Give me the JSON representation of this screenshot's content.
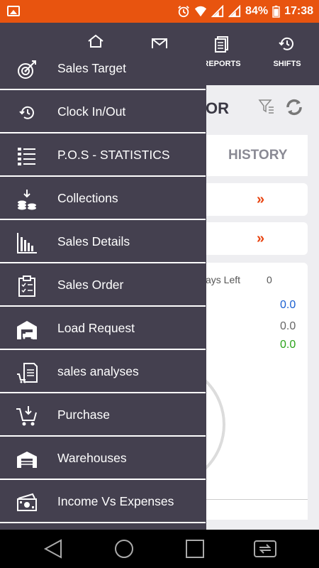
{
  "status_bar": {
    "battery_percent": "84%",
    "time": "17:38"
  },
  "background_app": {
    "tabs": [
      {
        "label": "",
        "icon": "home-icon"
      },
      {
        "label": "",
        "icon": "mail-icon"
      },
      {
        "label": "REPORTS",
        "icon": "reports-icon"
      },
      {
        "label": "SHIFTS",
        "icon": "history-icon"
      }
    ],
    "title_fragment": "OR",
    "history_label": "HISTORY",
    "arrow_glyph": "»",
    "days_left_label": "ays Left",
    "days_left_value": "0",
    "values": [
      {
        "text": "0.0",
        "color": "#1a5fd1"
      },
      {
        "text": "0.0",
        "color": "#666666"
      },
      {
        "text": "0.0",
        "color": "#2aa31a"
      }
    ]
  },
  "drawer": {
    "items": [
      {
        "label": "Sales Target",
        "icon": "target-icon"
      },
      {
        "label": "Clock In/Out",
        "icon": "clock-history-icon"
      },
      {
        "label": "P.O.S - STATISTICS",
        "icon": "list-icon"
      },
      {
        "label": "Collections",
        "icon": "coins-icon"
      },
      {
        "label": "Sales Details",
        "icon": "bar-chart-icon"
      },
      {
        "label": "Sales Order",
        "icon": "clipboard-icon"
      },
      {
        "label": "Load Request",
        "icon": "truck-warehouse-icon"
      },
      {
        "label": "sales analyses",
        "icon": "cart-document-icon"
      },
      {
        "label": "Purchase",
        "icon": "cart-download-icon"
      },
      {
        "label": "Warehouses",
        "icon": "warehouse-icon"
      },
      {
        "label": "Income Vs Expenses",
        "icon": "money-icon"
      }
    ]
  },
  "colors": {
    "status_bar": "#e8540f",
    "drawer_bg": "#44404f",
    "accent_arrow": "#e8430f"
  }
}
